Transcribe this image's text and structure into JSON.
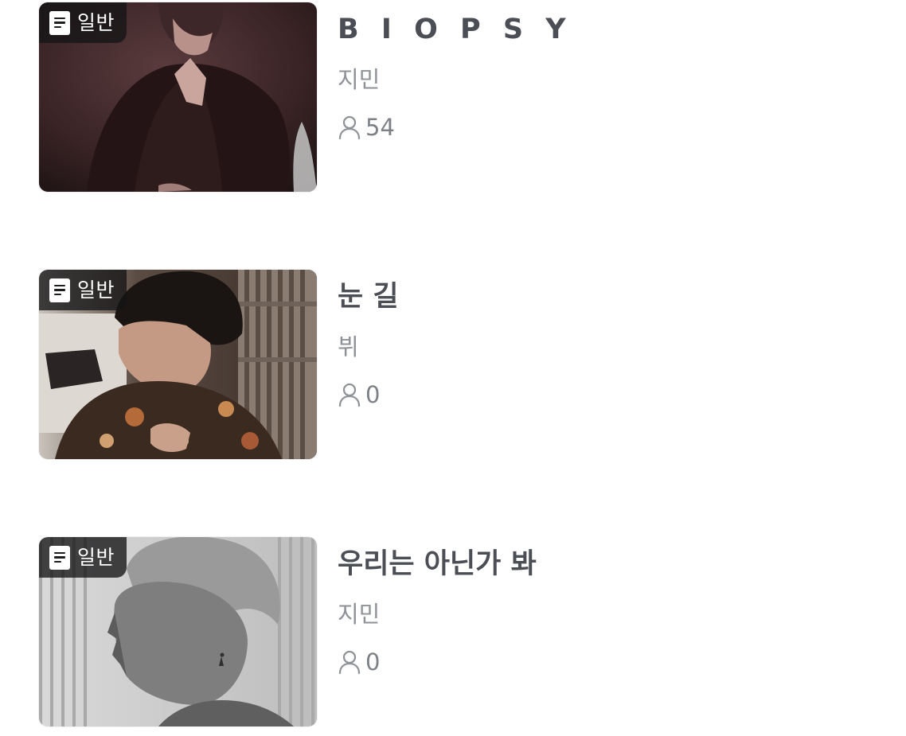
{
  "list": {
    "items": [
      {
        "badge": {
          "icon": "document-icon",
          "label": "일반"
        },
        "title": "B I O P S Y",
        "author": "지민",
        "views": "54"
      },
      {
        "badge": {
          "icon": "document-icon",
          "label": "일반"
        },
        "title": "눈 길",
        "author": "뷔",
        "views": "0"
      },
      {
        "badge": {
          "icon": "document-icon",
          "label": "일반"
        },
        "title": "우리는 아닌가 봐",
        "author": "지민",
        "views": "0"
      }
    ]
  },
  "colors": {
    "title": "#4b4e55",
    "author": "#8e9198",
    "views": "#7d8087",
    "badge_bg": "#141416"
  },
  "icons": {
    "badge": "document-icon",
    "views": "person-icon"
  }
}
